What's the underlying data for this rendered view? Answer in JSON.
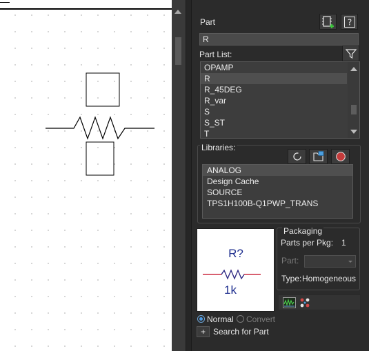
{
  "panel": {
    "part_label": "Part",
    "part_value": "R",
    "part_list_label": "Part List:",
    "part_list": [
      "OPAMP",
      "R",
      "R_45DEG",
      "R_var",
      "S",
      "S_ST",
      "T"
    ],
    "selected_part": "R",
    "libraries_label": "Libraries:",
    "libraries": [
      "ANALOG",
      "Design Cache",
      "SOURCE",
      "TPS1H100B-Q1PWP_TRANS"
    ],
    "selected_library": "ANALOG"
  },
  "preview": {
    "ref": "R?",
    "value": "1k"
  },
  "packaging": {
    "title": "Packaging",
    "parts_per_pkg_label": "Parts per Pkg:",
    "parts_per_pkg_value": "1",
    "part_label": "Part:",
    "part_value": "",
    "type_label": "Type:",
    "type_value": "Homogeneous"
  },
  "mode": {
    "normal_label": "Normal",
    "convert_label": "Convert",
    "selected": "Normal"
  },
  "search": {
    "button_label": "+",
    "label": "Search for Part"
  },
  "icons": {
    "add_part": "add-part-icon",
    "help": "help-icon",
    "filter": "filter-icon",
    "refresh": "refresh-icon",
    "browse": "browse-library-icon",
    "remove": "remove-library-icon",
    "simulation": "simulation-model-icon",
    "pcb_footprint": "pcb-footprint-icon"
  },
  "colors": {
    "panel_bg": "#2b2b2b",
    "preview_text": "#1f2f8f",
    "preview_wire": "#c0001a",
    "remove_button": "#c43b3b"
  }
}
